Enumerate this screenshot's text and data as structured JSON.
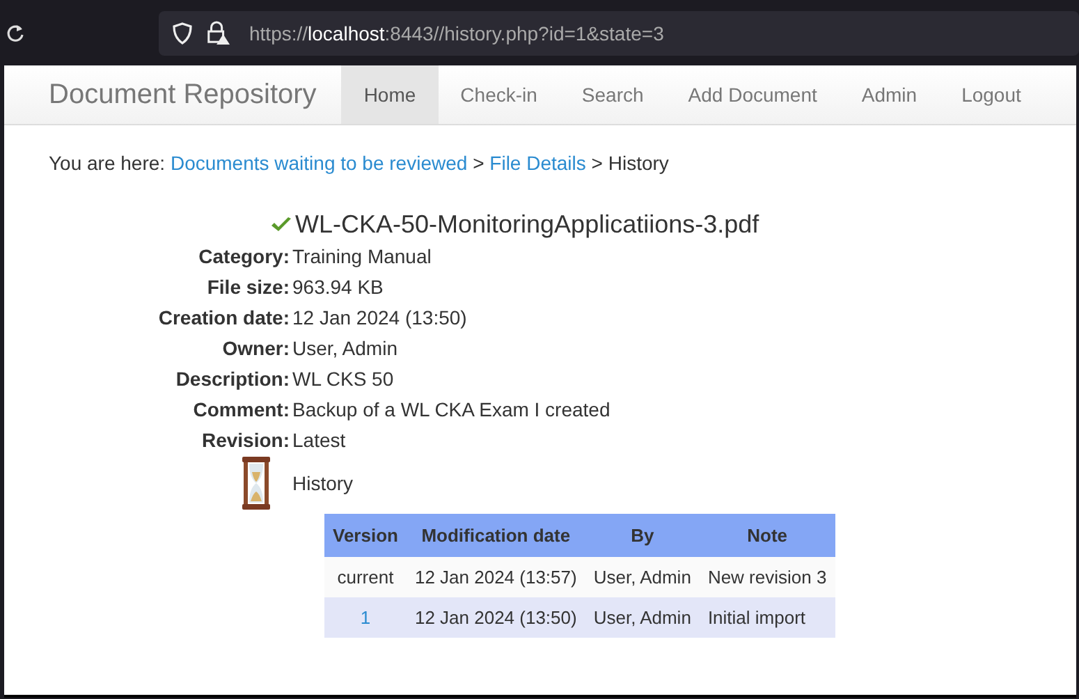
{
  "browser": {
    "url_parts": [
      {
        "text": "https://",
        "kind": "dim"
      },
      {
        "text": "localhost",
        "kind": "host"
      },
      {
        "text": ":8443//history.php?id=1&state=3",
        "kind": "dim"
      }
    ]
  },
  "navbar": {
    "brand": "Document Repository",
    "items": [
      {
        "label": "Home",
        "selected": true
      },
      {
        "label": "Check-in",
        "selected": false
      },
      {
        "label": "Search",
        "selected": false
      },
      {
        "label": "Add Document",
        "selected": false
      },
      {
        "label": "Admin",
        "selected": false
      },
      {
        "label": "Logout",
        "selected": false
      }
    ]
  },
  "breadcrumb": {
    "prefix": "You are here:",
    "parts": [
      {
        "text": "Documents waiting to be reviewed",
        "kind": "link"
      },
      {
        "text": ">",
        "kind": "sep"
      },
      {
        "text": "File Details",
        "kind": "link"
      },
      {
        "text": ">",
        "kind": "sep"
      },
      {
        "text": "History",
        "kind": "text"
      }
    ]
  },
  "file": {
    "name": "WL-CKA-50-MonitoringApplicatiions-3.pdf",
    "fields": [
      {
        "label": "Category:",
        "value": "Training Manual"
      },
      {
        "label": "File size:",
        "value": "963.94 KB"
      },
      {
        "label": "Creation date:",
        "value": "12 Jan 2024 (13:50)"
      },
      {
        "label": "Owner:",
        "value": "User, Admin"
      },
      {
        "label": "Description:",
        "value": "WL CKS 50"
      },
      {
        "label": "Comment:",
        "value": "Backup of a WL CKA Exam I created"
      },
      {
        "label": "Revision:",
        "value": "Latest"
      }
    ]
  },
  "history": {
    "title": "History",
    "columns": [
      "Version",
      "Modification date",
      "By",
      "Note"
    ],
    "rows": [
      {
        "version": "current",
        "link": false,
        "date": "12 Jan 2024 (13:57)",
        "by": "User, Admin",
        "note": "New revision 3"
      },
      {
        "version": "1",
        "link": true,
        "date": "12 Jan 2024 (13:50)",
        "by": "User, Admin",
        "note": "Initial import"
      }
    ]
  }
}
